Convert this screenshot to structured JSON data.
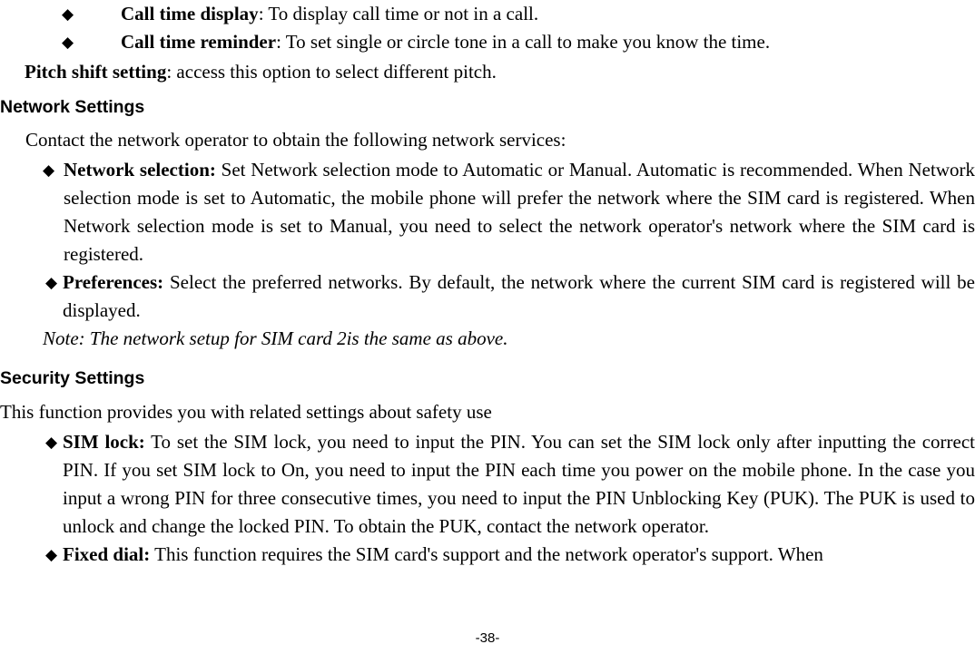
{
  "document": {
    "page_footer": "-38-",
    "bullet_glyph": "◆"
  },
  "top_list": {
    "items": [
      {
        "term": "Call time display",
        "separator": ": ",
        "description": "To display call time or not in a call."
      },
      {
        "term": "Call time reminder",
        "separator": ": ",
        "description": "To set single or circle tone in a call to make you know the time."
      }
    ]
  },
  "pitch_shift": {
    "term": "Pitch shift setting",
    "separator": ": ",
    "description": "access this option to select different pitch."
  },
  "network_settings": {
    "heading": "Network Settings",
    "intro": "Contact the network operator to obtain the following network services:",
    "items": [
      {
        "term": "Network selection:",
        "description": " Set Network selection mode to Automatic or Manual. Automatic is recommended.     When Network selection mode is set to Automatic, the mobile phone will prefer the network where the SIM card is registered. When Network selection mode is set to Manual, you need to select the network operator's network where the SIM card is registered."
      },
      {
        "term": "Preferences:",
        "description": " Select the preferred networks. By default, the network where the current SIM card is registered will be displayed."
      }
    ],
    "note": "Note: The network setup for SIM    card 2is the same as above."
  },
  "security_settings": {
    "heading": "Security Settings",
    "intro": "This function provides you with related settings about safety use",
    "items": [
      {
        "term": "SIM lock:",
        "description": " To set the SIM lock, you need to input the PIN. You can set the SIM lock only after inputting the correct PIN. If you set SIM lock to On, you need to input the PIN each time you power on the mobile phone. In the case you input a wrong PIN for three consecutive times, you need to input the PIN Unblocking Key (PUK). The PUK is used to unlock and change the locked PIN. To obtain the PUK, contact the network operator."
      },
      {
        "term": "Fixed dial:",
        "description": " This function requires the SIM card's support and the network operator's support. When"
      }
    ]
  }
}
